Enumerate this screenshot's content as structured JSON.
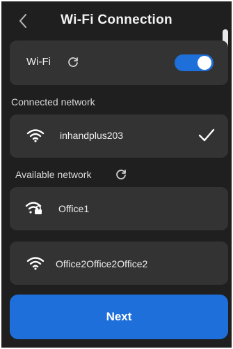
{
  "header": {
    "title": "Wi-Fi  Connection",
    "back_icon": "chevron-left-icon"
  },
  "wifi": {
    "label": "Wi-Fi",
    "refresh_icon": "refresh-icon",
    "enabled": true,
    "toggle_color": "#1e6fd9"
  },
  "connected": {
    "section_label": "Connected network",
    "network": {
      "name": "inhandplus203",
      "icon": "wifi-icon",
      "status_icon": "checkmark-icon"
    }
  },
  "available": {
    "section_label": "Available network",
    "refresh_icon": "refresh-icon",
    "networks": [
      {
        "name": "Office1",
        "icon": "wifi-locked-icon"
      },
      {
        "name": "Office2Office2Office2",
        "icon": "wifi-icon"
      }
    ]
  },
  "footer": {
    "next_label": "Next",
    "accent": "#1e6fd9"
  }
}
